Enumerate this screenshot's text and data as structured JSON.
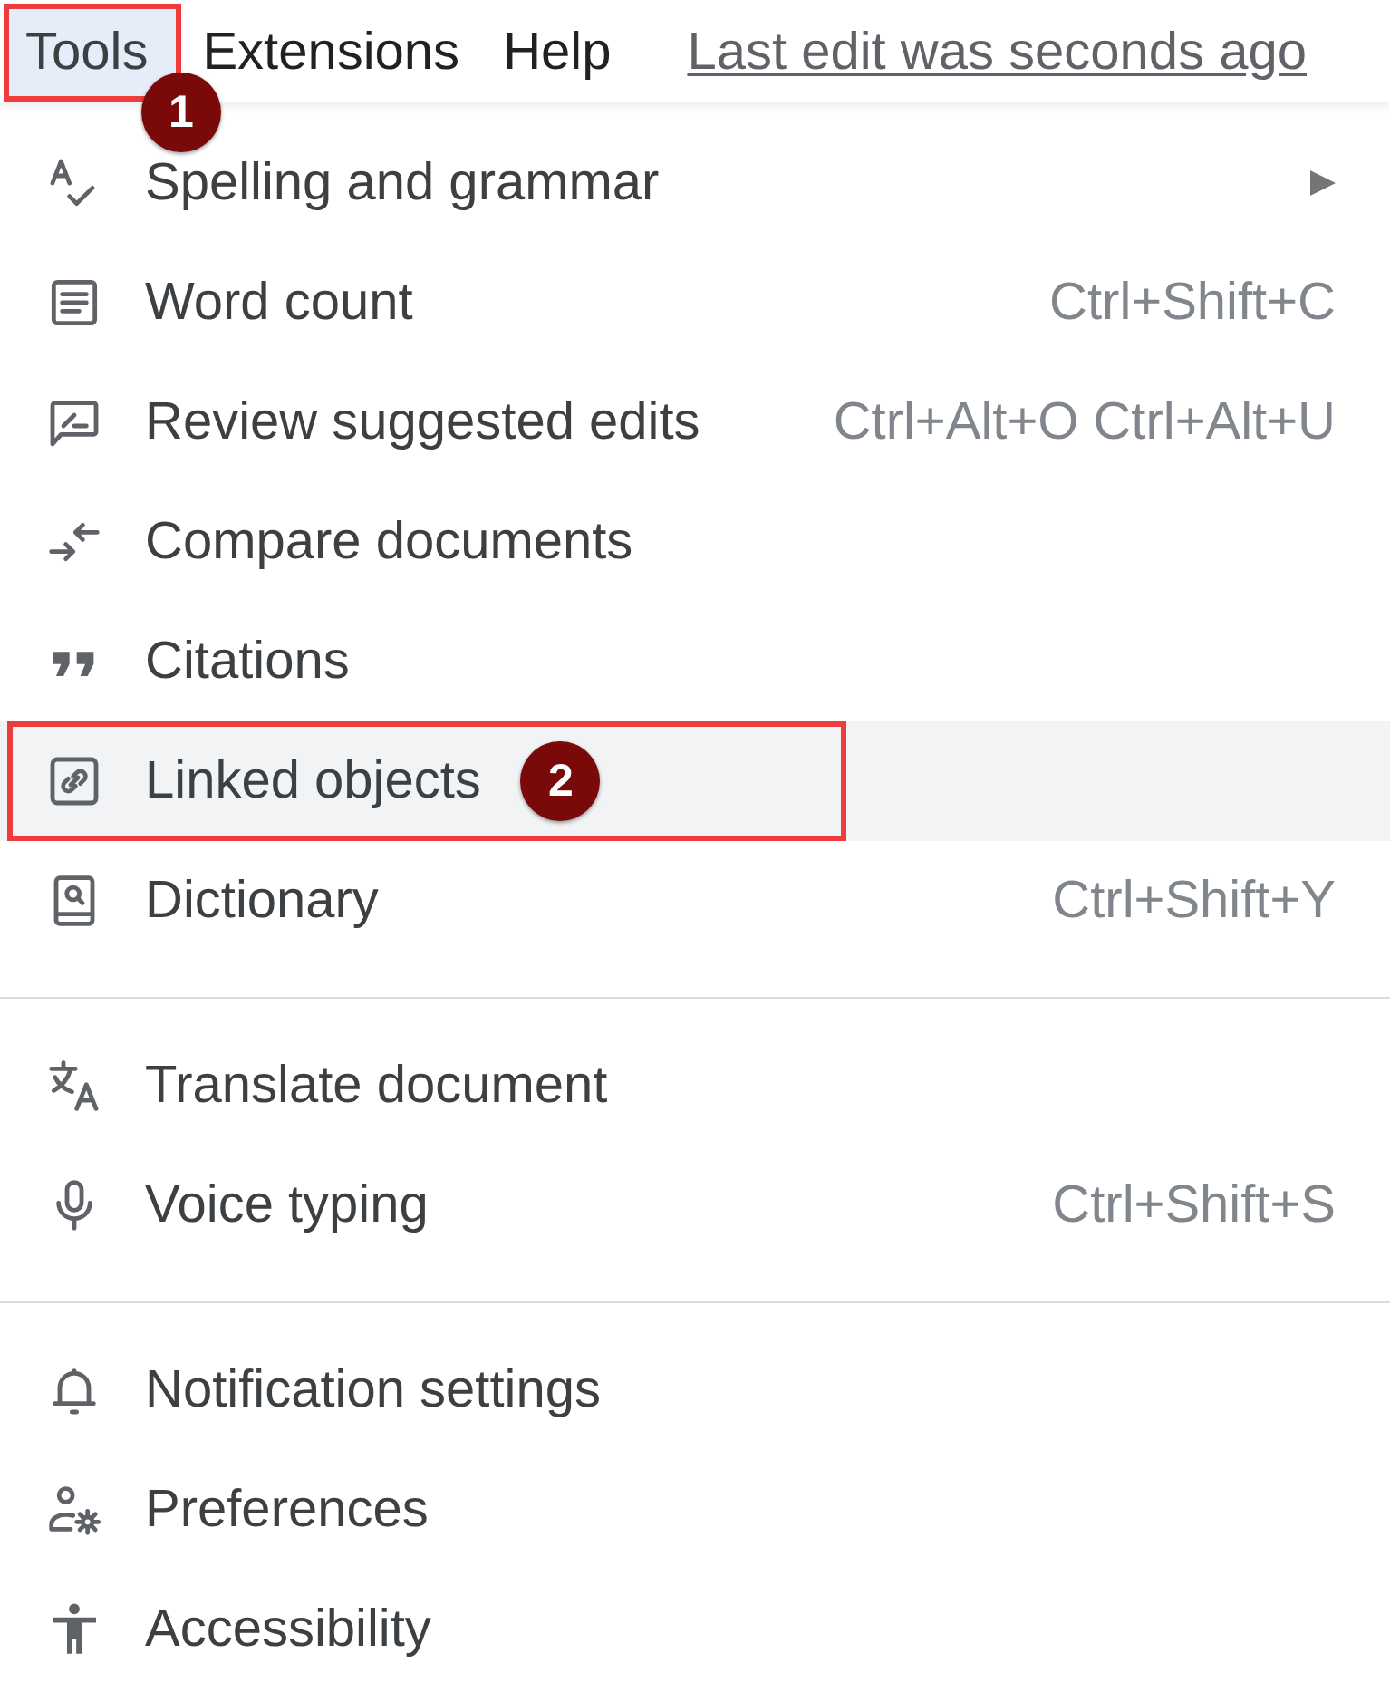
{
  "menu_bar": {
    "items": [
      {
        "label": "Tools",
        "selected": true,
        "callout": "1"
      },
      {
        "label": "Extensions",
        "selected": false
      },
      {
        "label": "Help",
        "selected": false
      }
    ],
    "last_edit": "Last edit was seconds ago"
  },
  "menu": {
    "sections": [
      [
        {
          "label": "Spelling and grammar",
          "submenu": true,
          "selected": false
        },
        {
          "label": "Word count",
          "shortcut": "Ctrl+Shift+C",
          "submenu": false,
          "selected": false
        },
        {
          "label": "Review suggested edits",
          "shortcut": "Ctrl+Alt+O Ctrl+Alt+U",
          "submenu": false,
          "selected": false
        },
        {
          "label": "Compare documents",
          "submenu": false,
          "selected": false
        },
        {
          "label": "Citations",
          "submenu": false,
          "selected": false
        },
        {
          "label": "Linked objects",
          "submenu": false,
          "selected": true,
          "callout": "2"
        },
        {
          "label": "Dictionary",
          "shortcut": "Ctrl+Shift+Y",
          "submenu": false,
          "selected": false
        }
      ],
      [
        {
          "label": "Translate document",
          "submenu": false,
          "selected": false
        },
        {
          "label": "Voice typing",
          "shortcut": "Ctrl+Shift+S",
          "submenu": false,
          "selected": false
        }
      ],
      [
        {
          "label": "Notification settings",
          "submenu": false,
          "selected": false
        },
        {
          "label": "Preferences",
          "submenu": false,
          "selected": false
        },
        {
          "label": "Accessibility",
          "submenu": false,
          "selected": false
        }
      ]
    ]
  }
}
